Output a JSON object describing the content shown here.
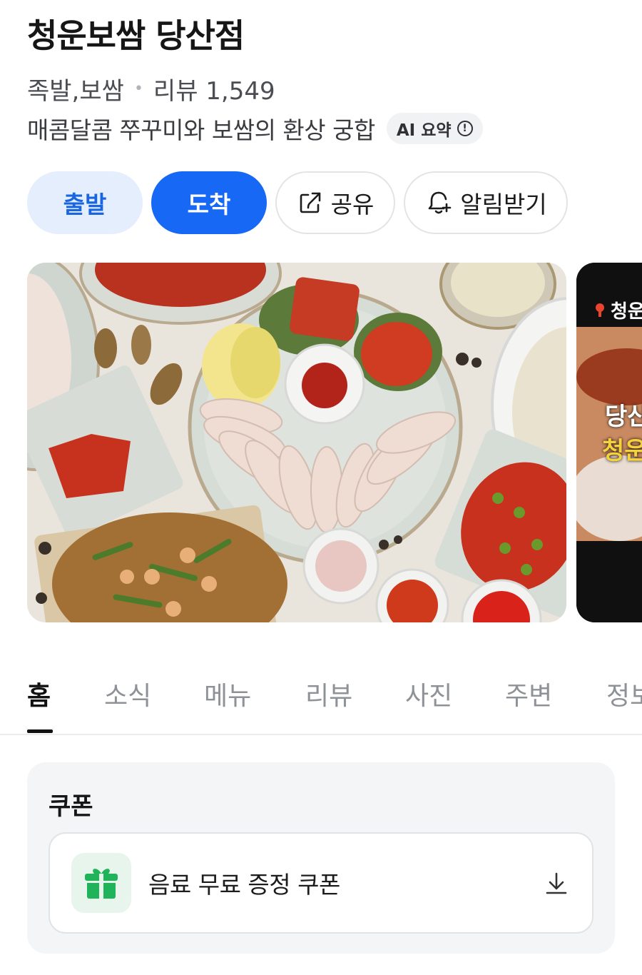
{
  "place": {
    "name": "청운보쌈 당산점",
    "category": "족발,보쌈",
    "review_label": "리뷰",
    "review_count": "1,549",
    "description": "매콤달콤 쭈꾸미와 보쌈의 환상 궁합",
    "ai_badge": "AI 요약",
    "ai_info_glyph": "!"
  },
  "actions": {
    "depart": "출발",
    "arrive": "도착",
    "share": "공유",
    "alert": "알림받기"
  },
  "photos": {
    "next_preview_pin": "청운",
    "next_preview_line1": "당산",
    "next_preview_line2": "청운"
  },
  "tabs": [
    "홈",
    "소식",
    "메뉴",
    "리뷰",
    "사진",
    "주변",
    "정보"
  ],
  "active_tab": "홈",
  "coupon": {
    "section_title": "쿠폰",
    "item_label": "음료 무료 증정 쿠폰",
    "icon": "gift-icon"
  },
  "colors": {
    "primary": "#1769f5",
    "primary_light": "#e4eefc",
    "gift_green": "#1fb35a"
  }
}
